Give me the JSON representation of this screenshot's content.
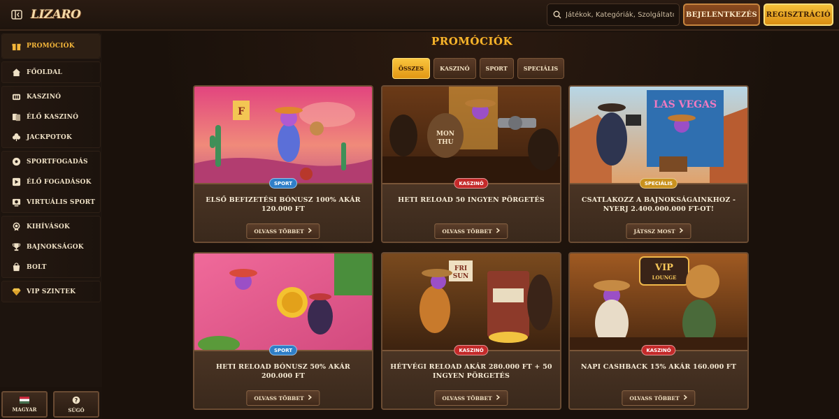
{
  "header": {
    "logo_text": "LIZARO",
    "search_placeholder": "Játékok, Kategóriák, Szolgáltatók",
    "login_label": "BEJELENTKEZÉS",
    "register_label": "REGISZTRÁCIÓ"
  },
  "sidebar": {
    "groups": [
      [
        {
          "label": "PROMÓCIÓK",
          "icon": "gift-icon",
          "active": true
        }
      ],
      [
        {
          "label": "FŐOLDAL",
          "icon": "home-icon"
        }
      ],
      [
        {
          "label": "KASZINÓ",
          "icon": "casino-icon"
        },
        {
          "label": "ÉLŐ KASZINÓ",
          "icon": "cards-icon"
        },
        {
          "label": "JACKPOTOK",
          "icon": "clover-icon"
        }
      ],
      [
        {
          "label": "SPORTFOGADÁS",
          "icon": "ball-icon"
        },
        {
          "label": "ÉLŐ FOGADÁSOK",
          "icon": "play-icon"
        },
        {
          "label": "VIRTUÁLIS SPORT",
          "icon": "virtual-icon"
        }
      ],
      [
        {
          "label": "KIHÍVÁSOK",
          "icon": "medal-icon"
        },
        {
          "label": "BAJNOKSÁGOK",
          "icon": "trophy-icon"
        },
        {
          "label": "BOLT",
          "icon": "shop-icon"
        }
      ],
      [
        {
          "label": "VIP SZINTEK",
          "icon": "diamond-icon"
        }
      ]
    ],
    "language_label": "MAGYAR",
    "help_label": "SÚGÓ"
  },
  "main": {
    "title": "PROMÓCIÓK",
    "tabs": [
      {
        "label": "ÖSSZES",
        "active": true
      },
      {
        "label": "KASZINÓ"
      },
      {
        "label": "SPORT"
      },
      {
        "label": "SPECIÁLIS"
      }
    ]
  },
  "cards": [
    {
      "badge": "SPORT",
      "badge_color": "#2f7fc8",
      "title": "ELSŐ BEFIZETÉSI BÓNUSZ 100% AKÁR 120.000 FT",
      "button": "OLVASS TÖBBET",
      "scene": "pink"
    },
    {
      "badge": "KASZINÓ",
      "badge_color": "#c42a2a",
      "title": "HETI RELOAD 50 INGYEN PÖRGETÉS",
      "button": "OLVASS TÖBBET",
      "scene": "saloon",
      "image_text": "MON THU"
    },
    {
      "badge": "SPECIÁLIS",
      "badge_color": "#c9921e",
      "title": "CSATLAKOZZ A BAJNOKSÁGAINKHOZ - NYERJ 2.400.000.000 FT-OT!",
      "button": "JÁTSSZ MOST",
      "scene": "vegas",
      "image_text": "LAS VEGAS"
    },
    {
      "badge": "SPORT",
      "badge_color": "#2f7fc8",
      "title": "HETI RELOAD BÓNUSZ 50% AKÁR 200.000 FT",
      "button": "OLVASS TÖBBET",
      "scene": "pinkcoin"
    },
    {
      "badge": "KASZINÓ",
      "badge_color": "#c42a2a",
      "title": "HÉTVÉGI RELOAD AKÁR 280.000 FT + 50 INGYEN PÖRGETÉS",
      "button": "OLVASS TÖBBET",
      "scene": "slot",
      "image_text": "FRI SUN"
    },
    {
      "badge": "KASZINÓ",
      "badge_color": "#c42a2a",
      "title": "NAPI CASHBACK 15% AKÁR 160.000 FT",
      "button": "OLVASS TÖBBET",
      "scene": "vip",
      "image_text": "VIP LOUNGE"
    }
  ]
}
